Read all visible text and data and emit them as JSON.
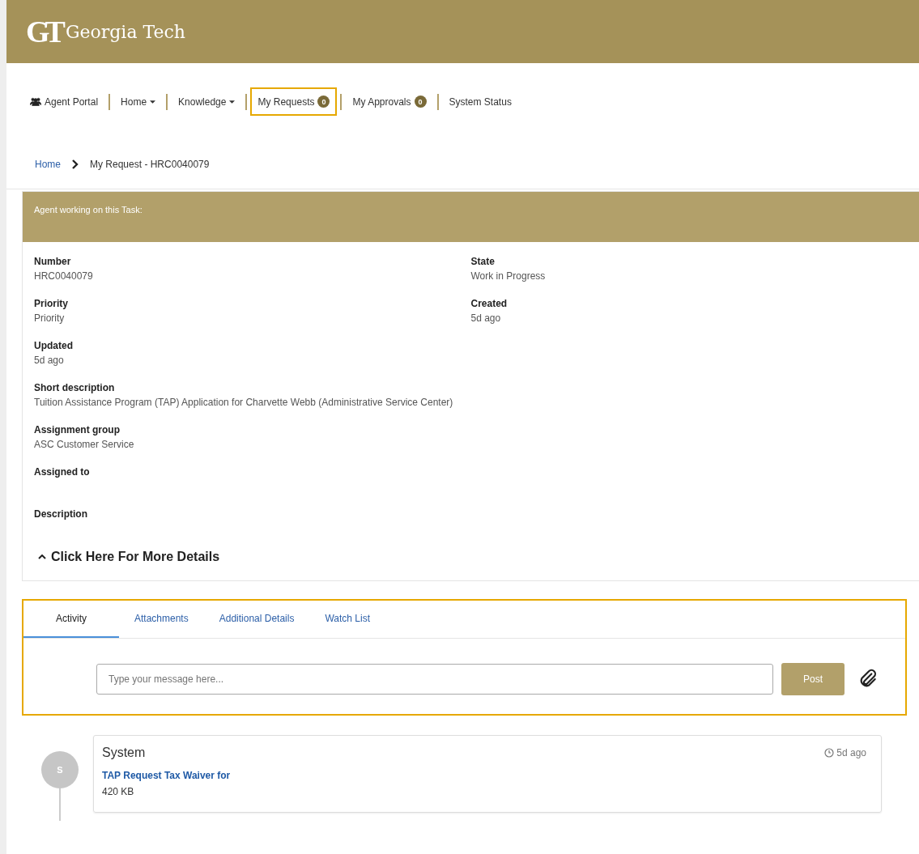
{
  "header": {
    "logo_mark": "GT",
    "title": "Georgia Tech"
  },
  "nav": [
    {
      "label": "Agent Portal",
      "kind": "icon-link",
      "highlighted": false
    },
    {
      "label": "Home",
      "kind": "dropdown",
      "highlighted": false
    },
    {
      "label": "Knowledge",
      "kind": "dropdown",
      "highlighted": false
    },
    {
      "label": "My Requests",
      "kind": "badge",
      "badge": "0",
      "highlighted": true
    },
    {
      "label": "My Approvals",
      "kind": "badge",
      "badge": "0",
      "highlighted": false
    },
    {
      "label": "System Status",
      "kind": "link",
      "highlighted": false
    }
  ],
  "breadcrumb": {
    "link": "Home",
    "current": "My Request - HRC0040079"
  },
  "task_card": {
    "banner": "Agent working on this Task:",
    "rows": [
      {
        "fields": [
          {
            "label": "Number",
            "value": "HRC0040079"
          },
          {
            "label": "State",
            "value": "Work in Progress"
          }
        ]
      },
      {
        "fields": [
          {
            "label": "Priority",
            "value": "Priority"
          },
          {
            "label": "Created",
            "value": "5d ago"
          }
        ]
      },
      {
        "fields": [
          {
            "label": "Updated",
            "value": "5d ago"
          }
        ]
      },
      {
        "fields": [
          {
            "label": "Short description",
            "value": "Tuition Assistance Program (TAP) Application for Charvette Webb (Administrative Service Center)"
          }
        ]
      },
      {
        "fields": [
          {
            "label": "Assignment group",
            "value": "ASC Customer Service"
          }
        ]
      },
      {
        "fields": [
          {
            "label": "Assigned to"
          }
        ]
      },
      {
        "fields": [
          {
            "label": "Description"
          }
        ]
      }
    ],
    "more_toggle": {
      "label": "Click Here For More Details",
      "expanded": true
    }
  },
  "activity_panel": {
    "highlighted": true,
    "tabs": [
      {
        "label": "Activity",
        "selected": true
      },
      {
        "label": "Attachments",
        "selected": false
      },
      {
        "label": "Additional Details",
        "selected": false
      },
      {
        "label": "Watch List",
        "selected": false
      }
    ],
    "message": {
      "placeholder": "Type your message here..."
    },
    "post_button": "Post"
  },
  "feed": [
    {
      "avatar": "S",
      "author": "System",
      "time": "5d ago",
      "link": "TAP Request Tax Waiver for",
      "size": "420 KB"
    }
  ]
}
